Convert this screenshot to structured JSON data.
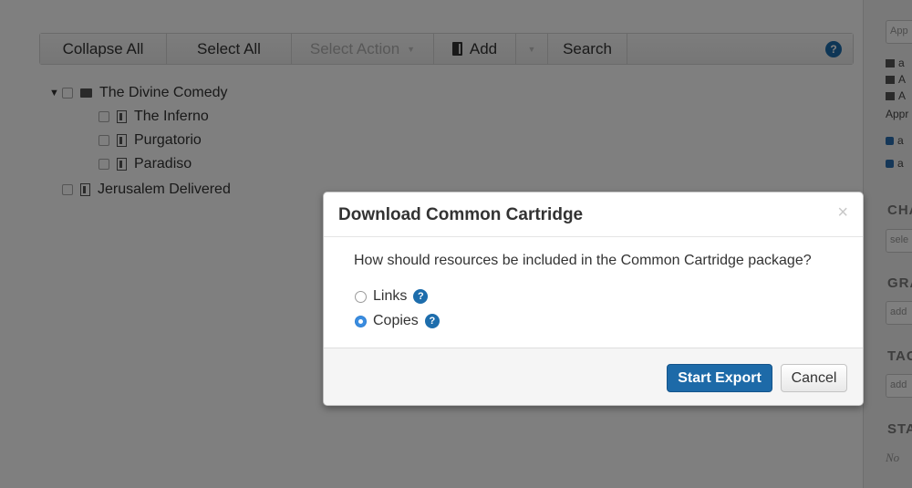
{
  "toolbar": {
    "collapse_all": "Collapse All",
    "select_all": "Select All",
    "select_action": "Select Action",
    "add": "Add",
    "search": "Search",
    "help": "?"
  },
  "tree": {
    "root": "The Divine Comedy",
    "children": [
      "The Inferno",
      "Purgatorio",
      "Paradiso"
    ],
    "sibling": "Jerusalem Delivered"
  },
  "sidebar": {
    "select_value": "App",
    "rows": [
      "a",
      "A",
      "A"
    ],
    "appr_label": "Appr",
    "checked": [
      "a",
      "a"
    ],
    "section1": "CHA",
    "section1_input": "sele",
    "section2": "GRA",
    "section2_input": "add",
    "section3": "TAG",
    "section3_input": "add",
    "section4": "STA",
    "section4_text": "No"
  },
  "modal": {
    "title": "Download Common Cartridge",
    "close": "×",
    "question": "How should resources be included in the Common Cartridge package?",
    "options": [
      {
        "label": "Links",
        "selected": false
      },
      {
        "label": "Copies",
        "selected": true
      }
    ],
    "help": "?",
    "start_label": "Start Export",
    "cancel_label": "Cancel"
  },
  "colors": {
    "primary": "#1d6aa8",
    "backdrop": "rgba(0,0,0,0.5)"
  }
}
